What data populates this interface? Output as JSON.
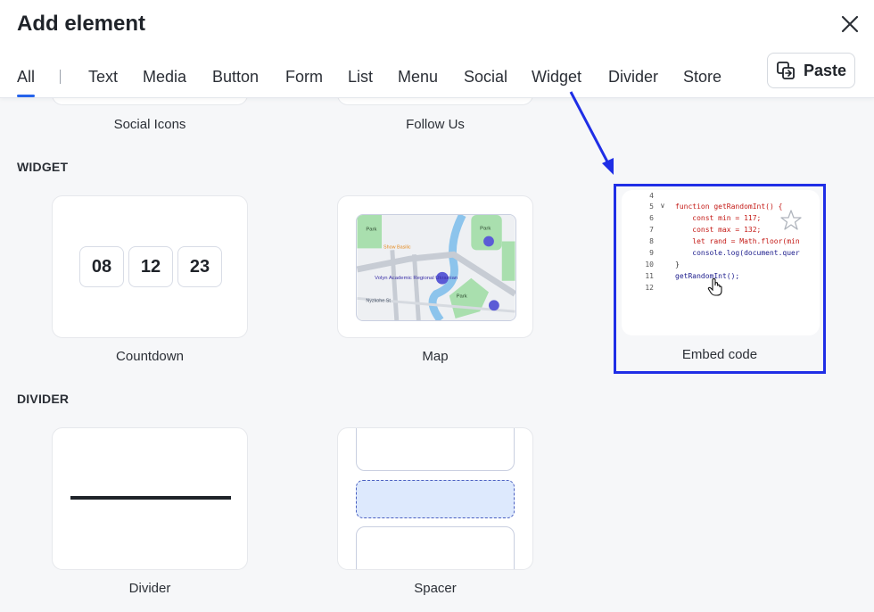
{
  "dialog": {
    "title": "Add element",
    "close_label": "close"
  },
  "tabs": [
    {
      "label": "All",
      "active": true
    },
    {
      "label": "Text"
    },
    {
      "label": "Media"
    },
    {
      "label": "Button"
    },
    {
      "label": "Form"
    },
    {
      "label": "List"
    },
    {
      "label": "Menu"
    },
    {
      "label": "Social"
    },
    {
      "label": "Widget"
    },
    {
      "label": "Divider"
    },
    {
      "label": "Store"
    }
  ],
  "paste_button": {
    "label": "Paste",
    "icon": "paste-icon"
  },
  "previous_section": {
    "items": [
      {
        "label": "Social Icons"
      },
      {
        "label": "Follow Us"
      }
    ]
  },
  "widget_section": {
    "title": "WIDGET",
    "items": [
      {
        "label": "Countdown",
        "digits": [
          "08",
          "12",
          "23"
        ]
      },
      {
        "label": "Map",
        "map_labels": {
          "park1": "Park",
          "park2": "Park",
          "park3": "Park",
          "place": "Show Basilic",
          "venue": "Volyn Academic Regional Ukrainian",
          "street": "Nyzkohe St"
        }
      },
      {
        "label": "Embed code",
        "code": {
          "lines": [
            {
              "num": "4",
              "text": ""
            },
            {
              "num": "5",
              "text": "function getRandomInt() {"
            },
            {
              "num": "6",
              "text": "    const min = 117;"
            },
            {
              "num": "7",
              "text": "    const max = 132;"
            },
            {
              "num": "8",
              "text": "    let rand = Math.floor(min"
            },
            {
              "num": "9",
              "text": "    console.log(document.quer"
            },
            {
              "num": "10",
              "text": "}"
            },
            {
              "num": "11",
              "text": "getRandomInt();"
            },
            {
              "num": "12",
              "text": ""
            }
          ]
        }
      }
    ]
  },
  "divider_section": {
    "title": "DIVIDER",
    "items": [
      {
        "label": "Divider"
      },
      {
        "label": "Spacer"
      }
    ]
  },
  "colors": {
    "accent": "#2563eb",
    "highlight": "#1f2ee6",
    "spacer_fill": "#dde9fd"
  }
}
